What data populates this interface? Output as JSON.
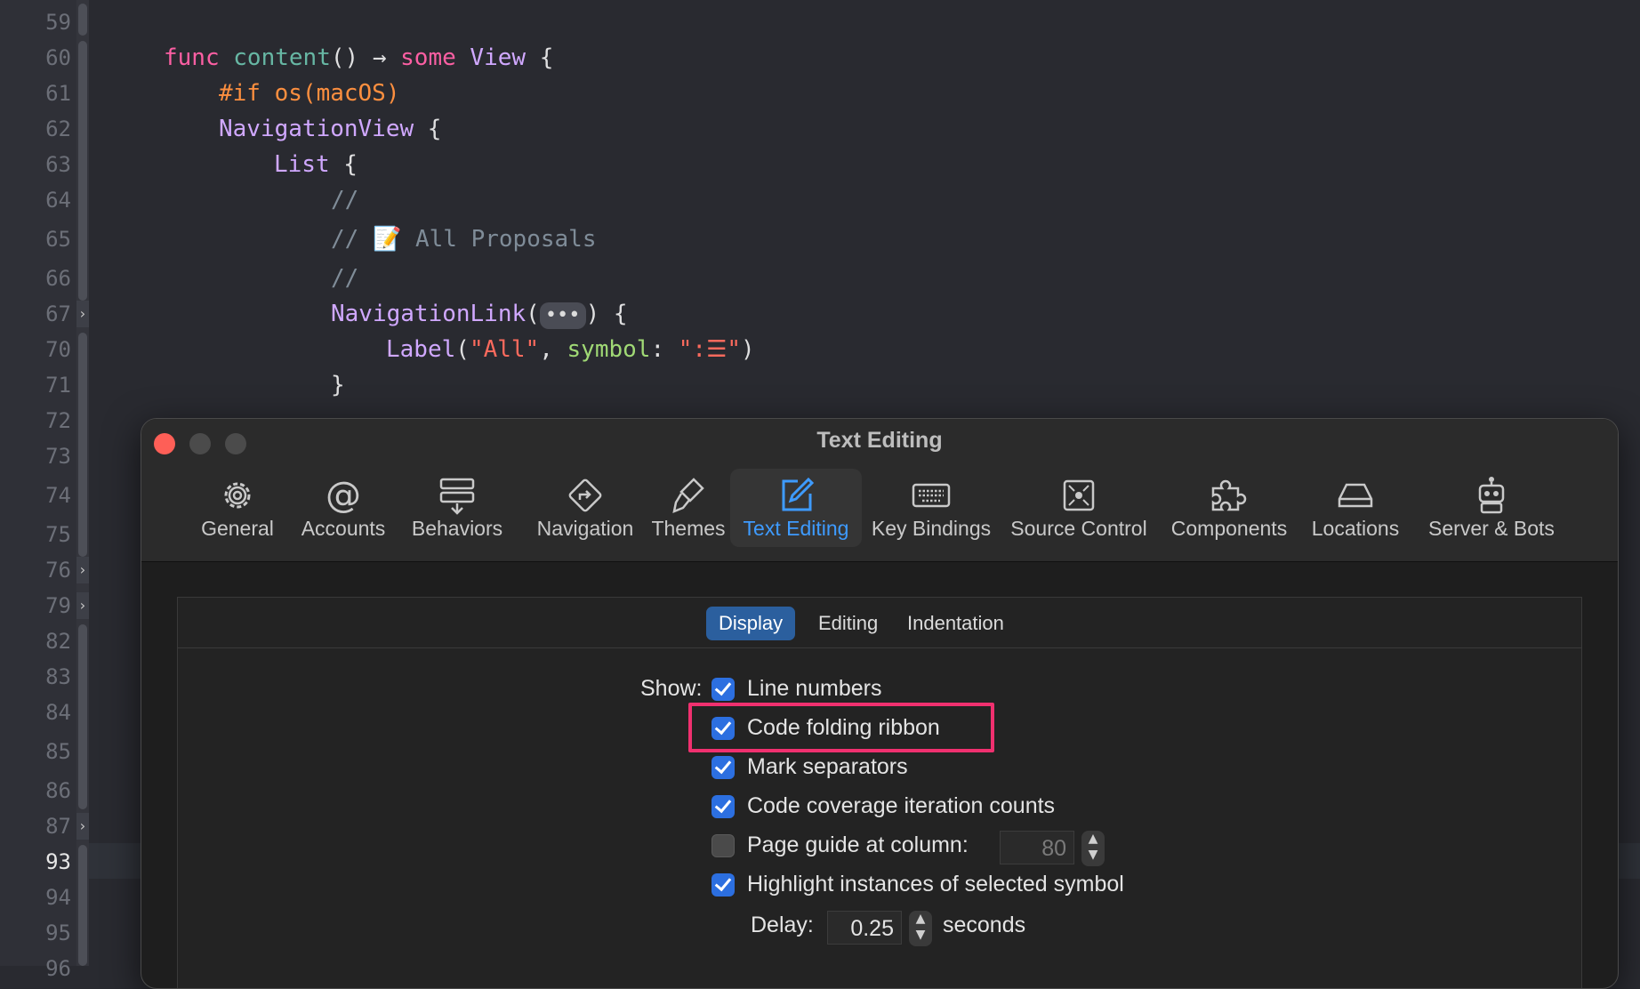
{
  "editor": {
    "line_numbers": [
      "59",
      "60",
      "61",
      "62",
      "63",
      "64",
      "65",
      "66",
      "67",
      "70",
      "71",
      "72",
      "73",
      "74",
      "75",
      "76",
      "79",
      "82",
      "83",
      "84",
      "85",
      "86",
      "87",
      "93",
      "94",
      "95",
      "96"
    ],
    "current_line": "93",
    "code": {
      "l60_kw": "func",
      "l60_fn": "content",
      "l60_rest": "() → ",
      "l60_kw2": "some",
      "l60_ty": "View",
      "l60_brace": " {",
      "l61": "#if os(macOS)",
      "l62_ty": "NavigationView",
      "l62_brace": " {",
      "l63_ty": "List",
      "l63_brace": " {",
      "l64": "//",
      "l65": "// 📝 All Proposals",
      "l66": "//",
      "l67_ty": "NavigationLink",
      "l67_open": "(",
      "l67_pill": "•••",
      "l67_close": ") {",
      "l70_ty": "Label",
      "l70_open": "(",
      "l70_str1": "\"All\"",
      "l70_comma": ", ",
      "l70_arg": "symbol",
      "l70_colon": ": ",
      "l70_str2": "\":☰\"",
      "l70_close": ")",
      "l71": "}"
    }
  },
  "window": {
    "title": "Text Editing",
    "toolbar": [
      {
        "label": "General",
        "icon": "gear-icon"
      },
      {
        "label": "Accounts",
        "icon": "at-icon"
      },
      {
        "label": "Behaviors",
        "icon": "behaviors-icon"
      },
      {
        "label": "Navigation",
        "icon": "navigation-icon"
      },
      {
        "label": "Themes",
        "icon": "brush-icon"
      },
      {
        "label": "Text Editing",
        "icon": "pencil-square-icon",
        "active": true
      },
      {
        "label": "Key Bindings",
        "icon": "keyboard-icon"
      },
      {
        "label": "Source Control",
        "icon": "source-control-icon"
      },
      {
        "label": "Components",
        "icon": "puzzle-icon"
      },
      {
        "label": "Locations",
        "icon": "drive-icon"
      },
      {
        "label": "Server & Bots",
        "icon": "robot-icon"
      }
    ],
    "tabs": [
      "Display",
      "Editing",
      "Indentation"
    ],
    "active_tab": "Display",
    "show_label": "Show:",
    "options": [
      {
        "label": "Line numbers",
        "checked": true
      },
      {
        "label": "Code folding ribbon",
        "checked": true,
        "highlighted": true
      },
      {
        "label": "Mark separators",
        "checked": true
      },
      {
        "label": "Code coverage iteration counts",
        "checked": true
      },
      {
        "label": "Page guide at column:",
        "checked": false
      },
      {
        "label": "Highlight instances of selected symbol",
        "checked": true
      }
    ],
    "page_guide_column": "80",
    "delay_label": "Delay:",
    "delay_value": "0.25",
    "delay_unit": "seconds",
    "accent_color": "#2c6fe0",
    "highlight_color": "#f0306f"
  }
}
